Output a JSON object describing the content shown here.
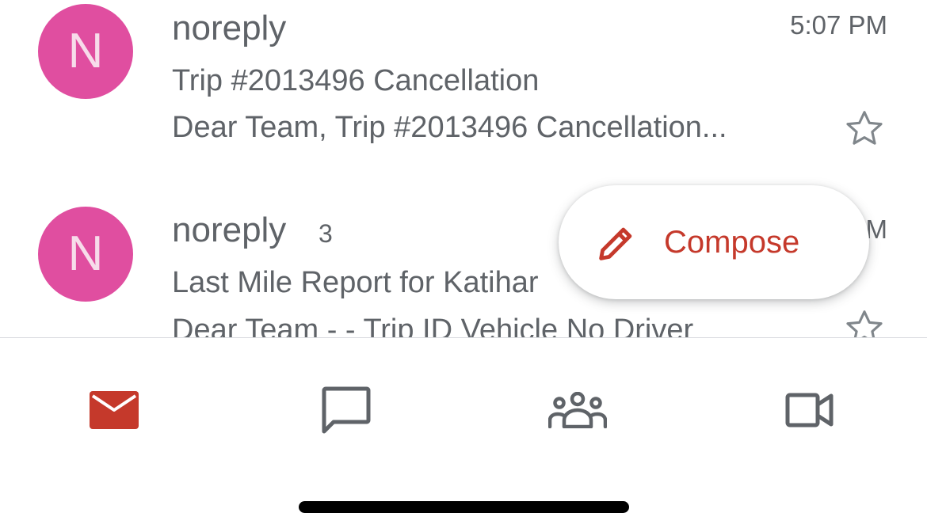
{
  "emails": [
    {
      "avatar_letter": "N",
      "avatar_color": "#e04ea0",
      "sender": "noreply",
      "count": "",
      "time": "5:07 PM",
      "subject": "Trip #2013496 Cancellation",
      "snippet": "Dear Team, Trip #2013496 Cancellation..."
    },
    {
      "avatar_letter": "N",
      "avatar_color": "#e04ea0",
      "sender": "noreply",
      "count": "3",
      "time": "M",
      "subject": "Last Mile Report for Katihar",
      "snippet": "Dear Team  - - Trip ID Vehicle No Driver"
    }
  ],
  "compose": {
    "label": "Compose",
    "icon": "pencil-icon",
    "color": "#c5392b"
  },
  "bottom_nav": {
    "items": [
      {
        "name": "mail",
        "icon": "mail-icon",
        "active": true,
        "color": "#c5392b"
      },
      {
        "name": "chat",
        "icon": "chat-icon",
        "active": false,
        "color": "#5f6368"
      },
      {
        "name": "spaces",
        "icon": "people-icon",
        "active": false,
        "color": "#5f6368"
      },
      {
        "name": "meet",
        "icon": "video-icon",
        "active": false,
        "color": "#5f6368"
      }
    ]
  },
  "colors": {
    "text_secondary": "#5f6368",
    "accent": "#c5392b",
    "avatar": "#e04ea0",
    "avatar_letter": "#f7dcea"
  }
}
